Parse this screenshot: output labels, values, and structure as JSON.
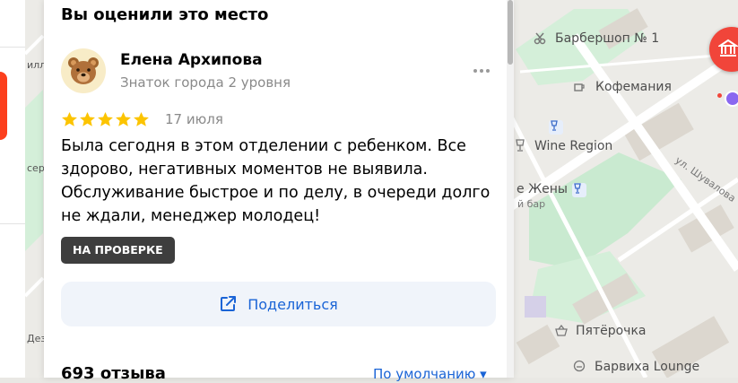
{
  "panel": {
    "header": "Вы оценили это место",
    "author": {
      "name": "Елена Архипова",
      "level": "Знаток города 2 уровня"
    },
    "rating": {
      "stars": 5,
      "max": 5
    },
    "date": "17 июля",
    "text": "Была сегодня в этом отделении с ребенком. Все здорово, негативных моментов не выявила. Обслуживание быстрое и по делу, в очереди долго не ждали, менеджер молодец!",
    "status_badge": "НА ПРОВЕРКЕ",
    "share_label": "Поделиться",
    "reviews_count": "693 отзыва",
    "sort_label": "По умолчанию ▾"
  },
  "map": {
    "pois": [
      {
        "label": "Барбершоп № 1",
        "icon": "scissors-icon"
      },
      {
        "label": "Кофемания",
        "icon": "coffee-icon"
      },
      {
        "label": "Wine Region",
        "icon": "glass-icon"
      },
      {
        "label": "е Жены",
        "icon": "glass-icon"
      },
      {
        "label": "й бар",
        "icon": ""
      },
      {
        "label": "Пятёрочка",
        "icon": "basket-icon"
      },
      {
        "label": "Барвиха Lounge",
        "icon": "lounge-icon"
      }
    ],
    "street": "ул. Шувалова",
    "edge_labels": [
      "илл",
      "сер",
      "Дез"
    ]
  },
  "colors": {
    "accent": "#1a64d6",
    "star": "#fcc400",
    "badge": "#3e3e3e",
    "brand_red": "#fc3f1d"
  }
}
